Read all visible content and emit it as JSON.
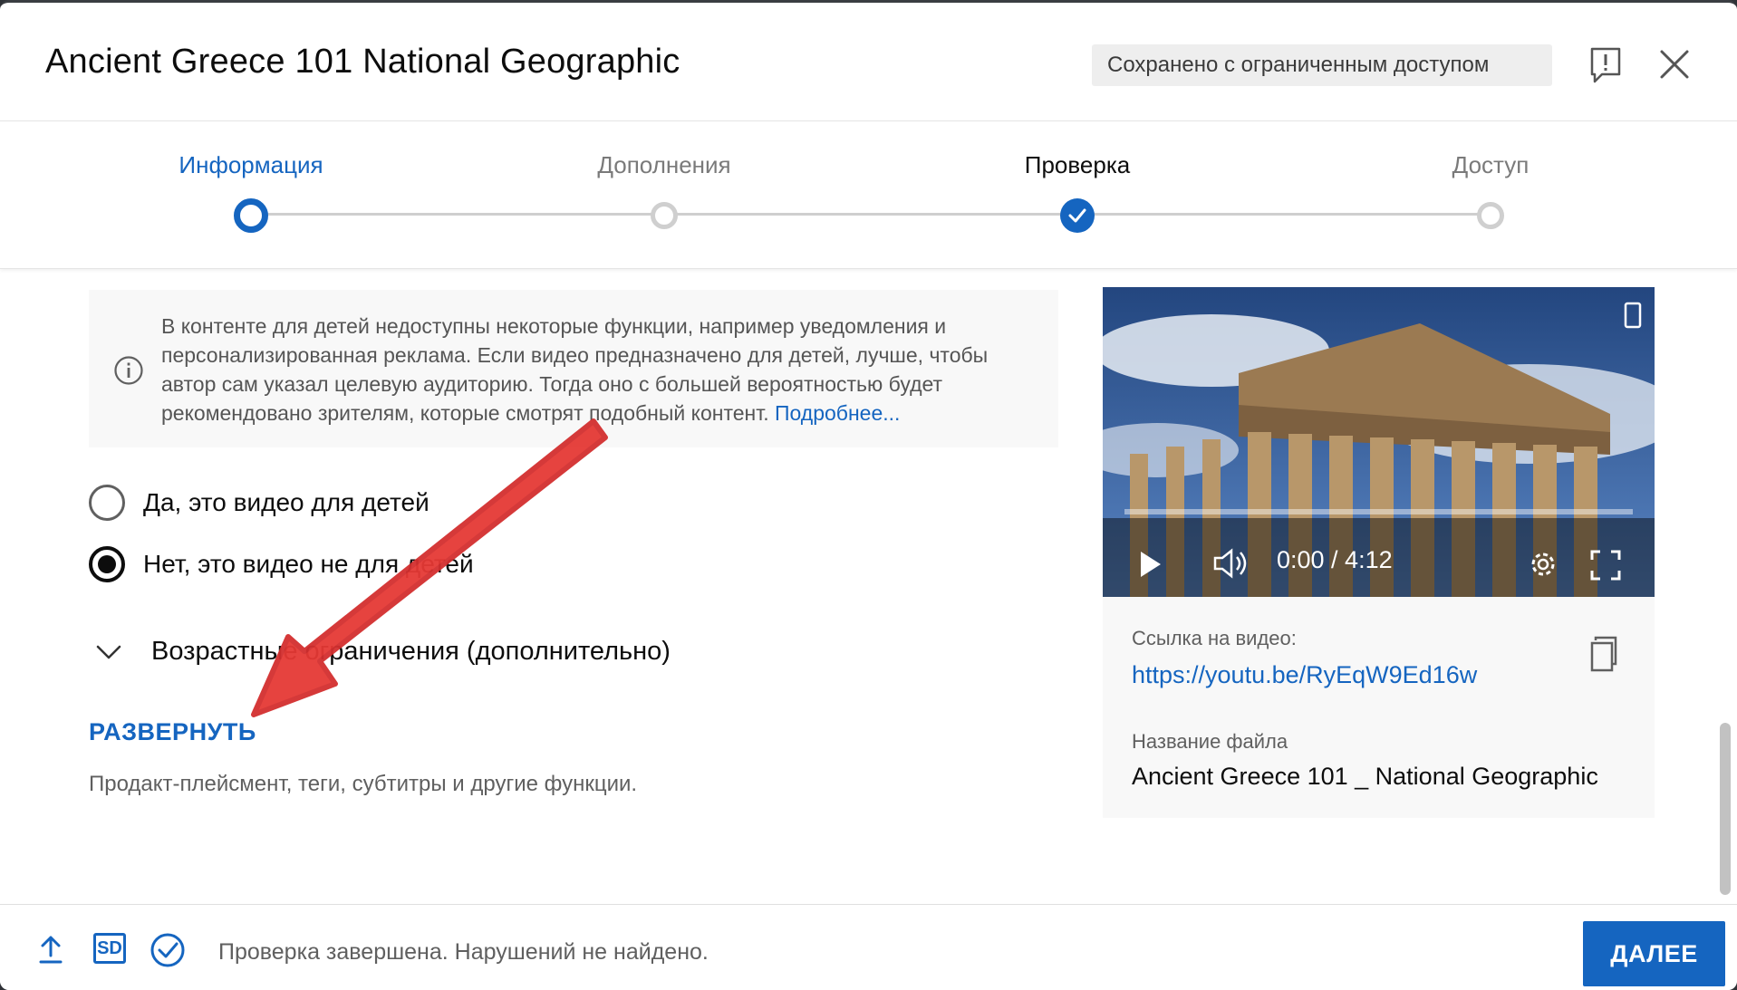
{
  "dialog": {
    "title": "Ancient Greece 101 National Geographic",
    "saved_badge": "Сохранено с ограниченным доступом"
  },
  "stepper": {
    "steps": [
      {
        "label": "Информация",
        "state": "active"
      },
      {
        "label": "Дополнения",
        "state": "pending"
      },
      {
        "label": "Проверка",
        "state": "done"
      },
      {
        "label": "Доступ",
        "state": "pending"
      }
    ]
  },
  "main": {
    "info": {
      "text": "В контенте для детей недоступны некоторые функции, например уведомления и персонализированная реклама. Если видео предназначено для детей, лучше, чтобы автор сам указал целевую аудиторию. Тогда оно с большей вероятностью будет рекомендовано зрителям, которые смотрят подобный контент.",
      "link": "Подробнее..."
    },
    "audience": {
      "yes_label": "Да, это видео для детей",
      "no_label": "Нет, это видео не для детей",
      "selected": "no"
    },
    "age_restrictions_label": "Возрастные ограничения (дополнительно)",
    "expand_label": "РАЗВЕРНУТЬ",
    "expand_description": "Продакт-плейсмент, теги, субтитры и другие функции."
  },
  "video": {
    "time": "0:00 / 4:12",
    "link_label": "Ссылка на видео:",
    "link": "https://youtu.be/RyEqW9Ed16w",
    "filename_label": "Название файла",
    "filename": "Ancient Greece 101 _ National Geographic"
  },
  "footer": {
    "status": "Проверка завершена. Нарушений не найдено.",
    "next_label": "ДАЛЕЕ",
    "quality_badge": "SD"
  },
  "colors": {
    "accent": "#1565c0",
    "annotation_arrow": "#e53935"
  }
}
